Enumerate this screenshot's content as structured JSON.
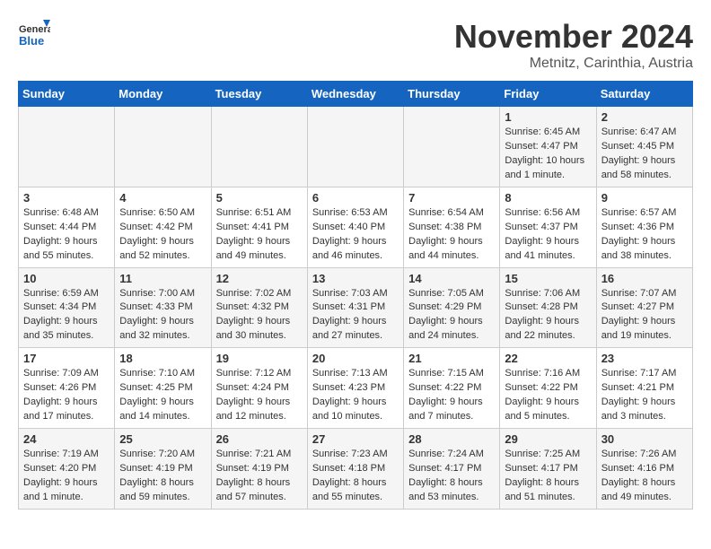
{
  "logo": {
    "text_general": "General",
    "text_blue": "Blue"
  },
  "title": "November 2024",
  "location": "Metnitz, Carinthia, Austria",
  "weekdays": [
    "Sunday",
    "Monday",
    "Tuesday",
    "Wednesday",
    "Thursday",
    "Friday",
    "Saturday"
  ],
  "weeks": [
    [
      {
        "day": "",
        "info": ""
      },
      {
        "day": "",
        "info": ""
      },
      {
        "day": "",
        "info": ""
      },
      {
        "day": "",
        "info": ""
      },
      {
        "day": "",
        "info": ""
      },
      {
        "day": "1",
        "info": "Sunrise: 6:45 AM\nSunset: 4:47 PM\nDaylight: 10 hours\nand 1 minute."
      },
      {
        "day": "2",
        "info": "Sunrise: 6:47 AM\nSunset: 4:45 PM\nDaylight: 9 hours\nand 58 minutes."
      }
    ],
    [
      {
        "day": "3",
        "info": "Sunrise: 6:48 AM\nSunset: 4:44 PM\nDaylight: 9 hours\nand 55 minutes."
      },
      {
        "day": "4",
        "info": "Sunrise: 6:50 AM\nSunset: 4:42 PM\nDaylight: 9 hours\nand 52 minutes."
      },
      {
        "day": "5",
        "info": "Sunrise: 6:51 AM\nSunset: 4:41 PM\nDaylight: 9 hours\nand 49 minutes."
      },
      {
        "day": "6",
        "info": "Sunrise: 6:53 AM\nSunset: 4:40 PM\nDaylight: 9 hours\nand 46 minutes."
      },
      {
        "day": "7",
        "info": "Sunrise: 6:54 AM\nSunset: 4:38 PM\nDaylight: 9 hours\nand 44 minutes."
      },
      {
        "day": "8",
        "info": "Sunrise: 6:56 AM\nSunset: 4:37 PM\nDaylight: 9 hours\nand 41 minutes."
      },
      {
        "day": "9",
        "info": "Sunrise: 6:57 AM\nSunset: 4:36 PM\nDaylight: 9 hours\nand 38 minutes."
      }
    ],
    [
      {
        "day": "10",
        "info": "Sunrise: 6:59 AM\nSunset: 4:34 PM\nDaylight: 9 hours\nand 35 minutes."
      },
      {
        "day": "11",
        "info": "Sunrise: 7:00 AM\nSunset: 4:33 PM\nDaylight: 9 hours\nand 32 minutes."
      },
      {
        "day": "12",
        "info": "Sunrise: 7:02 AM\nSunset: 4:32 PM\nDaylight: 9 hours\nand 30 minutes."
      },
      {
        "day": "13",
        "info": "Sunrise: 7:03 AM\nSunset: 4:31 PM\nDaylight: 9 hours\nand 27 minutes."
      },
      {
        "day": "14",
        "info": "Sunrise: 7:05 AM\nSunset: 4:29 PM\nDaylight: 9 hours\nand 24 minutes."
      },
      {
        "day": "15",
        "info": "Sunrise: 7:06 AM\nSunset: 4:28 PM\nDaylight: 9 hours\nand 22 minutes."
      },
      {
        "day": "16",
        "info": "Sunrise: 7:07 AM\nSunset: 4:27 PM\nDaylight: 9 hours\nand 19 minutes."
      }
    ],
    [
      {
        "day": "17",
        "info": "Sunrise: 7:09 AM\nSunset: 4:26 PM\nDaylight: 9 hours\nand 17 minutes."
      },
      {
        "day": "18",
        "info": "Sunrise: 7:10 AM\nSunset: 4:25 PM\nDaylight: 9 hours\nand 14 minutes."
      },
      {
        "day": "19",
        "info": "Sunrise: 7:12 AM\nSunset: 4:24 PM\nDaylight: 9 hours\nand 12 minutes."
      },
      {
        "day": "20",
        "info": "Sunrise: 7:13 AM\nSunset: 4:23 PM\nDaylight: 9 hours\nand 10 minutes."
      },
      {
        "day": "21",
        "info": "Sunrise: 7:15 AM\nSunset: 4:22 PM\nDaylight: 9 hours\nand 7 minutes."
      },
      {
        "day": "22",
        "info": "Sunrise: 7:16 AM\nSunset: 4:22 PM\nDaylight: 9 hours\nand 5 minutes."
      },
      {
        "day": "23",
        "info": "Sunrise: 7:17 AM\nSunset: 4:21 PM\nDaylight: 9 hours\nand 3 minutes."
      }
    ],
    [
      {
        "day": "24",
        "info": "Sunrise: 7:19 AM\nSunset: 4:20 PM\nDaylight: 9 hours\nand 1 minute."
      },
      {
        "day": "25",
        "info": "Sunrise: 7:20 AM\nSunset: 4:19 PM\nDaylight: 8 hours\nand 59 minutes."
      },
      {
        "day": "26",
        "info": "Sunrise: 7:21 AM\nSunset: 4:19 PM\nDaylight: 8 hours\nand 57 minutes."
      },
      {
        "day": "27",
        "info": "Sunrise: 7:23 AM\nSunset: 4:18 PM\nDaylight: 8 hours\nand 55 minutes."
      },
      {
        "day": "28",
        "info": "Sunrise: 7:24 AM\nSunset: 4:17 PM\nDaylight: 8 hours\nand 53 minutes."
      },
      {
        "day": "29",
        "info": "Sunrise: 7:25 AM\nSunset: 4:17 PM\nDaylight: 8 hours\nand 51 minutes."
      },
      {
        "day": "30",
        "info": "Sunrise: 7:26 AM\nSunset: 4:16 PM\nDaylight: 8 hours\nand 49 minutes."
      }
    ]
  ]
}
